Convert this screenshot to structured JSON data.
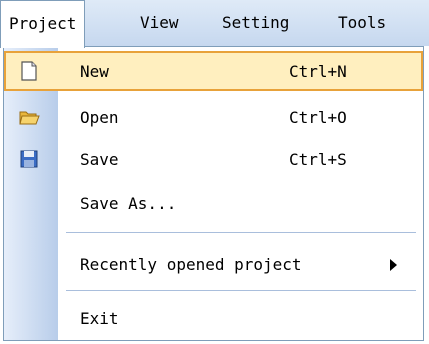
{
  "menubar": {
    "items": [
      {
        "label": "Project"
      },
      {
        "label": "View"
      },
      {
        "label": "Setting"
      },
      {
        "label": "Tools"
      }
    ]
  },
  "menu": {
    "items": [
      {
        "label": "New",
        "shortcut": "Ctrl+N",
        "icon": "new-file-icon"
      },
      {
        "label": "Open",
        "shortcut": "Ctrl+O",
        "icon": "open-folder-icon"
      },
      {
        "label": "Save",
        "shortcut": "Ctrl+S",
        "icon": "save-disk-icon"
      },
      {
        "label": "Save As..."
      },
      {
        "label": "Recently opened project",
        "icon": "submenu-arrow-icon"
      },
      {
        "label": "Exit"
      }
    ]
  },
  "colors": {
    "highlight_bg": "#ffefbf",
    "highlight_border": "#e8a23a",
    "border": "#7f9db9"
  }
}
